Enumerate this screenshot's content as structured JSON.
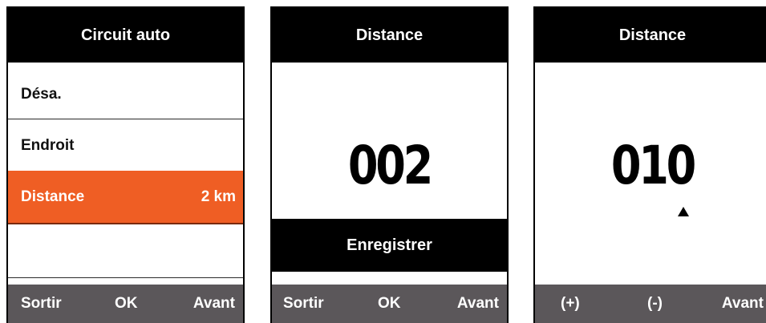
{
  "screens": [
    {
      "title": "Circuit auto",
      "menu": [
        {
          "label": "Désa.",
          "value": ""
        },
        {
          "label": "Endroit",
          "value": ""
        },
        {
          "label": "Distance",
          "value": "2 km",
          "selected": true
        }
      ],
      "softkeys": {
        "left": "Sortir",
        "center": "OK",
        "right": "Avant"
      }
    },
    {
      "title": "Distance",
      "value": "002",
      "action": "Enregistrer",
      "softkeys": {
        "left": "Sortir",
        "center": "OK",
        "right": "Avant"
      }
    },
    {
      "title": "Distance",
      "value": "010",
      "cursor_digit": 3,
      "softkeys": {
        "left": "(+)",
        "center": "(-)",
        "right": "Avant"
      }
    }
  ],
  "colors": {
    "accent": "#ef5e24",
    "softkey_bar": "#5b575a",
    "title_bar": "#000000"
  }
}
